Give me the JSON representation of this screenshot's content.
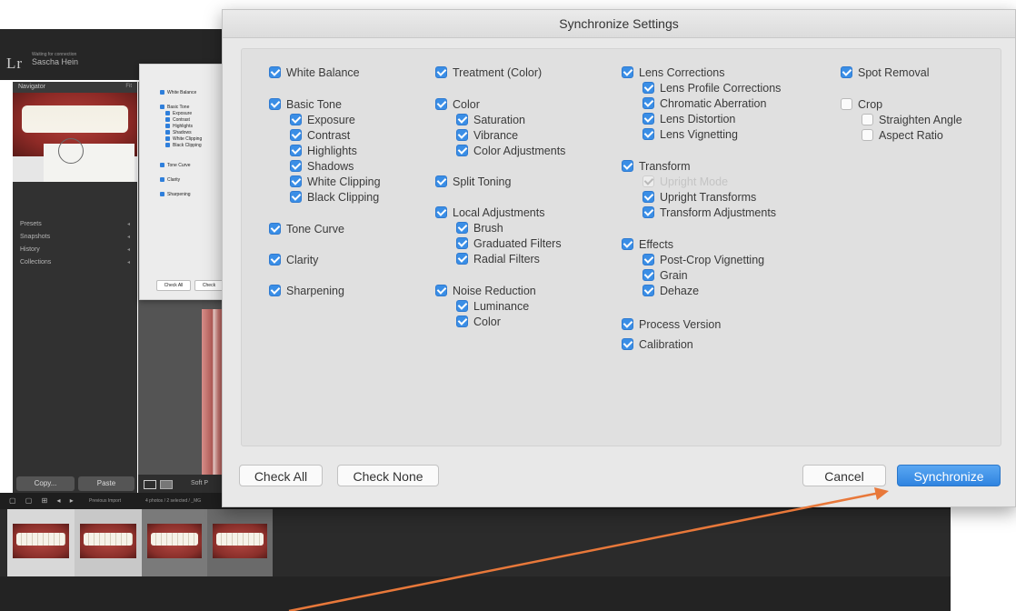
{
  "lightroom": {
    "app_logo": "Lr",
    "status": "Waiting for connection",
    "user": "Sascha Hein",
    "navigator": {
      "title": "Navigator",
      "fit": "Fit"
    },
    "panels": [
      "Presets",
      "Snapshots",
      "History",
      "Collections"
    ],
    "copy_label": "Copy...",
    "paste_label": "Paste",
    "soft_proofing": "Soft P",
    "filmstrip": {
      "source": "Previous Import",
      "count": "4 photos / 2 selected / _MG"
    }
  },
  "ghost_dialog": {
    "items": [
      "White Balance",
      "Basic Tone",
      "Exposure",
      "Contrast",
      "Highlights",
      "Shadows",
      "White Clipping",
      "Black Clipping",
      "Tone Curve",
      "Clarity",
      "Sharpening"
    ],
    "check_all": "Check All",
    "check": "Check"
  },
  "dialog": {
    "title": "Synchronize Settings",
    "col1": {
      "white_balance": "White Balance",
      "basic_tone": "Basic Tone",
      "exposure": "Exposure",
      "contrast": "Contrast",
      "highlights": "Highlights",
      "shadows": "Shadows",
      "white_clipping": "White Clipping",
      "black_clipping": "Black Clipping",
      "tone_curve": "Tone Curve",
      "clarity": "Clarity",
      "sharpening": "Sharpening"
    },
    "col2": {
      "treatment": "Treatment (Color)",
      "color": "Color",
      "saturation": "Saturation",
      "vibrance": "Vibrance",
      "color_adjustments": "Color Adjustments",
      "split_toning": "Split Toning",
      "local_adjustments": "Local Adjustments",
      "brush": "Brush",
      "graduated_filters": "Graduated Filters",
      "radial_filters": "Radial Filters",
      "noise_reduction": "Noise Reduction",
      "luminance": "Luminance",
      "nr_color": "Color"
    },
    "col3": {
      "lens_corrections": "Lens Corrections",
      "lens_profile": "Lens Profile Corrections",
      "chromatic_aberration": "Chromatic Aberration",
      "lens_distortion": "Lens Distortion",
      "lens_vignetting": "Lens Vignetting",
      "transform": "Transform",
      "upright_mode": "Upright Mode",
      "upright_transforms": "Upright Transforms",
      "transform_adjustments": "Transform Adjustments",
      "effects": "Effects",
      "post_crop_vignetting": "Post-Crop Vignetting",
      "grain": "Grain",
      "dehaze": "Dehaze",
      "process_version": "Process Version",
      "calibration": "Calibration"
    },
    "col4": {
      "spot_removal": "Spot Removal",
      "crop": "Crop",
      "straighten_angle": "Straighten Angle",
      "aspect_ratio": "Aspect Ratio"
    },
    "buttons": {
      "check_all": "Check All",
      "check_none": "Check None",
      "cancel": "Cancel",
      "synchronize": "Synchronize"
    }
  },
  "colors": {
    "accent": "#3a8ee6",
    "arrow": "#e8783a"
  }
}
